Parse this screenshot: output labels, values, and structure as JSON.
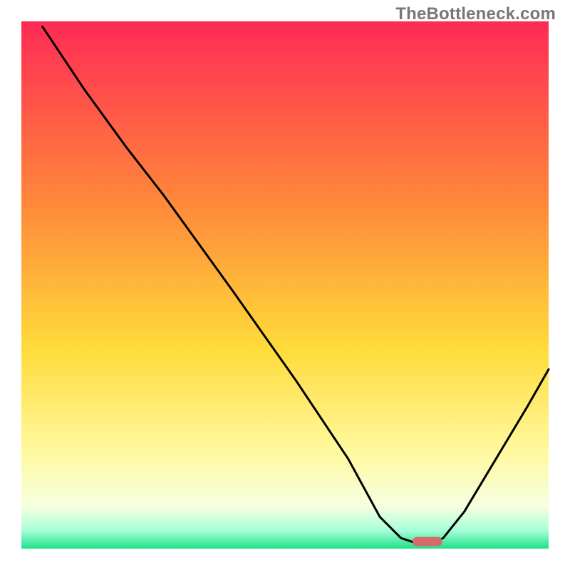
{
  "attribution": "TheBottleneck.com",
  "colors": {
    "gradient_top": "#ff2a55",
    "gradient_mid1": "#ff8a3a",
    "gradient_mid2": "#ffdb3a",
    "gradient_mid3": "#fff9a0",
    "gradient_low1": "#f6ffe0",
    "gradient_low2": "#a8ffd8",
    "gradient_bottom": "#1fe08a",
    "curve": "#000000",
    "marker": "#d46a6a",
    "axis": "#000000"
  },
  "chart_data": {
    "type": "line",
    "title": "",
    "xlabel": "",
    "ylabel": "",
    "xlim": [
      0,
      100
    ],
    "ylim": [
      0,
      100
    ],
    "curve": [
      {
        "x": 4,
        "y": 99
      },
      {
        "x": 12,
        "y": 87
      },
      {
        "x": 20,
        "y": 76
      },
      {
        "x": 27,
        "y": 67
      },
      {
        "x": 40,
        "y": 49
      },
      {
        "x": 52,
        "y": 32
      },
      {
        "x": 62,
        "y": 17
      },
      {
        "x": 68,
        "y": 6
      },
      {
        "x": 72,
        "y": 2
      },
      {
        "x": 75,
        "y": 1
      },
      {
        "x": 78,
        "y": 1
      },
      {
        "x": 80,
        "y": 2
      },
      {
        "x": 84,
        "y": 7
      },
      {
        "x": 90,
        "y": 17
      },
      {
        "x": 96,
        "y": 27
      },
      {
        "x": 100,
        "y": 34
      }
    ],
    "marker": {
      "x_center": 77,
      "half_width": 2.8,
      "y": 1.4
    },
    "annotations": []
  }
}
